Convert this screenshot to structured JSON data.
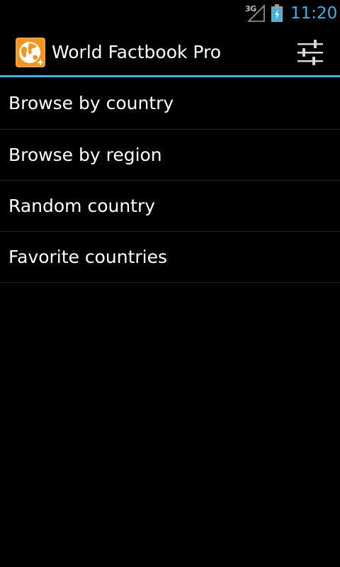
{
  "status_bar": {
    "network_type": "3G",
    "time": "11:20",
    "icons": [
      "signal-icon",
      "battery-charging-icon"
    ]
  },
  "action_bar": {
    "title": "World Factbook Pro",
    "app_icon": "globe-app-icon",
    "settings_icon": "sliders-icon"
  },
  "menu": {
    "items": [
      {
        "label": "Browse by country"
      },
      {
        "label": "Browse by region"
      },
      {
        "label": "Random country"
      },
      {
        "label": "Favorite countries"
      }
    ]
  },
  "colors": {
    "accent": "#33b5e5",
    "app_icon_orange": "#f7941d",
    "background": "#000000"
  }
}
